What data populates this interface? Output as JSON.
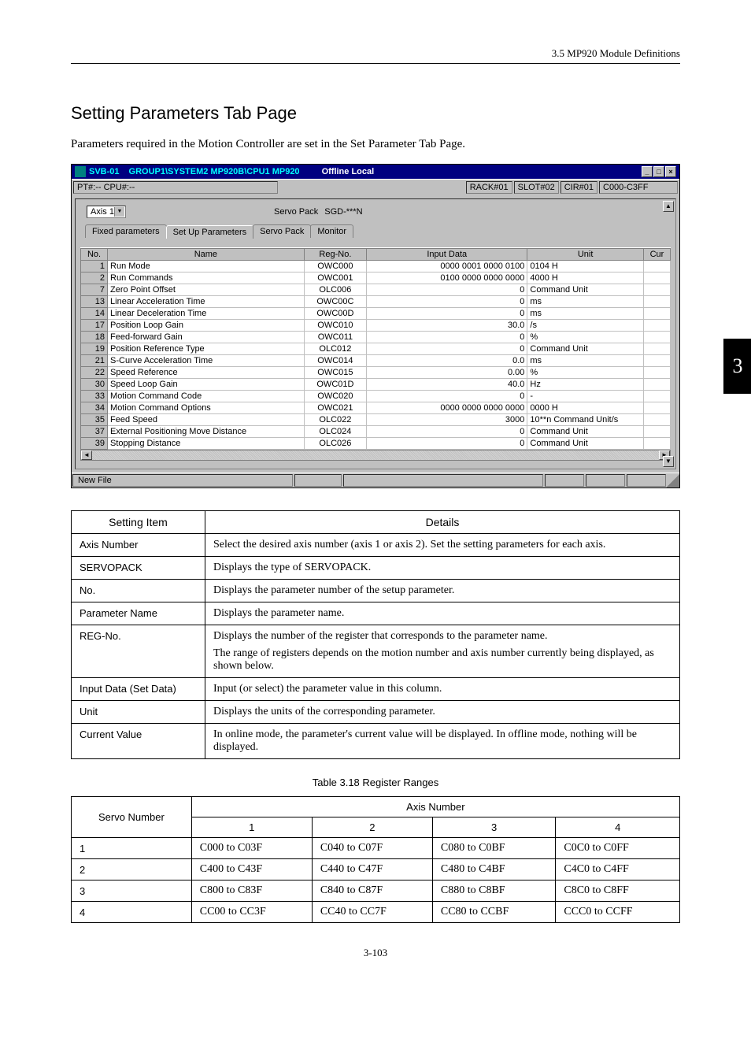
{
  "header": {
    "right": "3.5 MP920 Module Definitions"
  },
  "sidetab": "3",
  "section": {
    "title": "Setting Parameters Tab Page",
    "intro": "Parameters required in the Motion Controller are set in the Set Parameter Tab Page."
  },
  "win": {
    "title_app": "SVB-01",
    "title_path": "GROUP1\\SYSTEM2 MP920B\\CPU1 MP920",
    "title_mode": "Offline Local",
    "status1": {
      "pt": "PT#:-- CPU#:--",
      "rack": "RACK#01",
      "slot": "SLOT#02",
      "cir": "CIR#01",
      "addr": "C000-C3FF"
    },
    "axis": {
      "selected": "Axis 1",
      "servo_label": "Servo Pack",
      "servo_value": "SGD-***N"
    },
    "tabs": [
      "Fixed parameters",
      "Set Up Parameters",
      "Servo Pack",
      "Monitor"
    ],
    "grid": {
      "headers": {
        "no": "No.",
        "name": "Name",
        "reg": "Reg-No.",
        "data": "Input Data",
        "unit": "Unit",
        "cur": "Cur"
      },
      "rows": [
        {
          "no": "1",
          "name": "Run Mode",
          "reg": "OWC000",
          "data": "0000 0001 0000 0100",
          "unit": "0104 H"
        },
        {
          "no": "2",
          "name": "Run Commands",
          "reg": "OWC001",
          "data": "0100 0000 0000 0000",
          "unit": "4000 H"
        },
        {
          "no": "7",
          "name": "Zero Point Offset",
          "reg": "OLC006",
          "data": "0",
          "unit": "Command Unit"
        },
        {
          "no": "13",
          "name": "Linear Acceleration Time",
          "reg": "OWC00C",
          "data": "0",
          "unit": "ms"
        },
        {
          "no": "14",
          "name": "Linear Deceleration Time",
          "reg": "OWC00D",
          "data": "0",
          "unit": "ms"
        },
        {
          "no": "17",
          "name": "Position Loop Gain",
          "reg": "OWC010",
          "data": "30.0",
          "unit": "/s"
        },
        {
          "no": "18",
          "name": "Feed-forward Gain",
          "reg": "OWC011",
          "data": "0",
          "unit": "%"
        },
        {
          "no": "19",
          "name": "Position Reference Type",
          "reg": "OLC012",
          "data": "0",
          "unit": "Command Unit"
        },
        {
          "no": "21",
          "name": "S-Curve Acceleration Time",
          "reg": "OWC014",
          "data": "0.0",
          "unit": "ms"
        },
        {
          "no": "22",
          "name": "Speed Reference",
          "reg": "OWC015",
          "data": "0.00",
          "unit": "%"
        },
        {
          "no": "30",
          "name": "Speed Loop Gain",
          "reg": "OWC01D",
          "data": "40.0",
          "unit": "Hz"
        },
        {
          "no": "33",
          "name": "Motion Command Code",
          "reg": "OWC020",
          "data": "0",
          "unit": "-"
        },
        {
          "no": "34",
          "name": "Motion Command Options",
          "reg": "OWC021",
          "data": "0000 0000 0000 0000",
          "unit": "0000 H"
        },
        {
          "no": "35",
          "name": "Feed Speed",
          "reg": "OLC022",
          "data": "3000",
          "unit": "10**n Command Unit/s"
        },
        {
          "no": "37",
          "name": "External Positioning Move Distance",
          "reg": "OLC024",
          "data": "0",
          "unit": "Command Unit"
        },
        {
          "no": "39",
          "name": "Stopping Distance",
          "reg": "OLC026",
          "data": "0",
          "unit": "Command Unit"
        }
      ]
    },
    "statusbar": "New File"
  },
  "details": {
    "headers": {
      "item": "Setting Item",
      "details": "Details"
    },
    "rows": [
      {
        "label": "Axis Number",
        "text": "Select the desired axis number (axis 1 or axis 2). Set the setting parameters for each axis."
      },
      {
        "label": "SERVOPACK",
        "text": "Displays the type of SERVOPACK."
      },
      {
        "label": "No.",
        "text": "Displays the parameter number of the setup parameter."
      },
      {
        "label": "Parameter Name",
        "text": "Displays the parameter name."
      },
      {
        "label": "REG-No.",
        "text": "Displays the number of the register that corresponds to the parameter name.\nThe range of registers depends on the motion number and axis number currently being displayed, as shown below."
      },
      {
        "label": "Input Data (Set Data)",
        "text": "Input (or select) the parameter value in this column."
      },
      {
        "label": "Unit",
        "text": "Displays the units of the corresponding parameter."
      },
      {
        "label": "Current Value",
        "text": "In online mode, the parameter's current value will be displayed. In offline mode, nothing will be displayed."
      }
    ]
  },
  "caption": "Table 3.18  Register Ranges",
  "ranges": {
    "corner": "Servo Number",
    "axis_header": "Axis Number",
    "axis_nums": [
      "1",
      "2",
      "3",
      "4"
    ],
    "rows": [
      {
        "sn": "1",
        "cells": [
          "C000 to C03F",
          "C040 to C07F",
          "C080 to C0BF",
          "C0C0 to C0FF"
        ]
      },
      {
        "sn": "2",
        "cells": [
          "C400 to C43F",
          "C440 to C47F",
          "C480 to C4BF",
          "C4C0 to C4FF"
        ]
      },
      {
        "sn": "3",
        "cells": [
          "C800 to C83F",
          "C840 to C87F",
          "C880 to C8BF",
          "C8C0 to C8FF"
        ]
      },
      {
        "sn": "4",
        "cells": [
          "CC00 to CC3F",
          "CC40 to CC7F",
          "CC80 to CCBF",
          "CCC0 to CCFF"
        ]
      }
    ]
  },
  "page_num": "3-103"
}
